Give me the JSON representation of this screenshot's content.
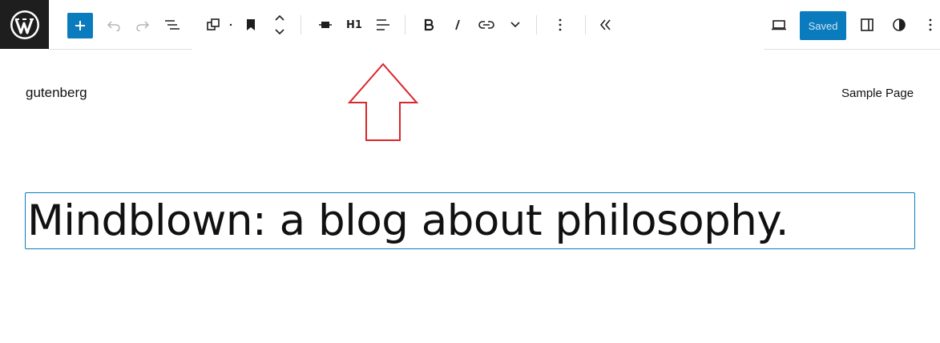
{
  "toolbar": {
    "add_label": "+",
    "h1_label": "H1",
    "saved_label": "Saved",
    "icons": [
      "wordpress-logo",
      "plus-icon",
      "undo-icon",
      "redo-icon",
      "document-overview-icon",
      "block-transform-icon",
      "bookmark-icon",
      "chevron-up-icon",
      "chevron-down-icon",
      "align-center-icon",
      "heading-level-icon",
      "text-align-icon",
      "bold-icon",
      "italic-icon",
      "link-icon",
      "more-chevron-icon",
      "block-options-icon",
      "collapse-toolbar-icon",
      "preview-device-icon",
      "settings-sidebar-icon",
      "styles-icon",
      "options-menu-icon"
    ]
  },
  "site": {
    "title": "gutenberg",
    "nav_link": "Sample Page"
  },
  "content": {
    "heading": "Mindblown: a blog about philosophy."
  },
  "colors": {
    "accent": "#0a7bbd",
    "logo_bg": "#1e1e1e",
    "annotation_arrow": "#d9262c"
  }
}
